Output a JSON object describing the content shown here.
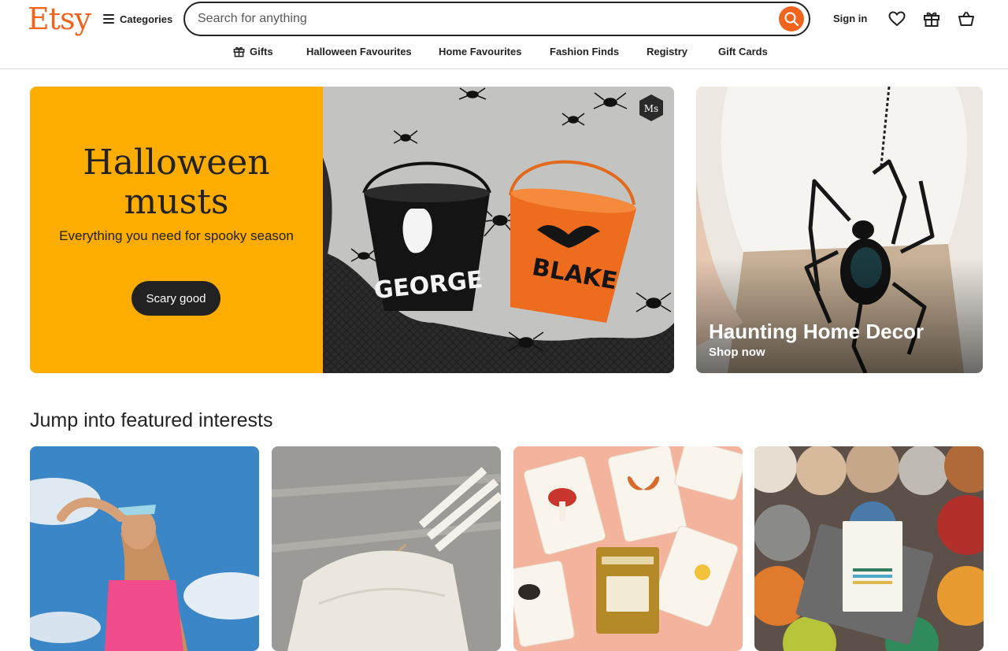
{
  "header": {
    "logo": "Etsy",
    "categories_label": "Categories",
    "search_placeholder": "Search for anything",
    "signin_label": "Sign in"
  },
  "subnav": {
    "items": [
      "Gifts",
      "Halloween Favourites",
      "Home Favourites",
      "Fashion Finds",
      "Registry",
      "Gift Cards"
    ]
  },
  "hero": {
    "title": "Halloween musts",
    "subtitle": "Everything you need for spooky season",
    "button_label": "Scary good",
    "bucket_name_1": "GEORGE",
    "bucket_name_2": "BLAKE"
  },
  "side_promo": {
    "title": "Haunting Home Decor",
    "cta": "Shop now"
  },
  "featured": {
    "title": "Jump into featured interests"
  },
  "colors": {
    "brand_orange": "#f1641e",
    "hero_yellow": "#fdac00",
    "text_dark": "#222222"
  },
  "icons": [
    "menu-icon",
    "search-icon",
    "heart-icon",
    "gift-icon",
    "basket-icon"
  ]
}
